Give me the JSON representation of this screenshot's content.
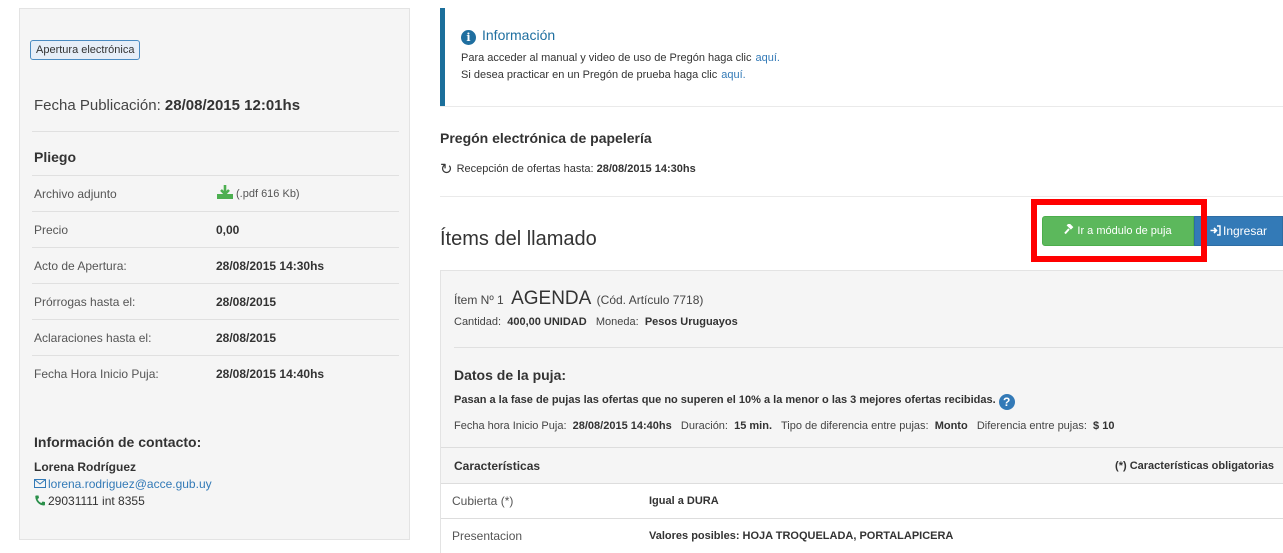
{
  "left": {
    "badge": "Apertura electrónica",
    "pub_label": "Fecha Publicación:",
    "pub_value": "28/08/2015 12:01hs",
    "pliego_title": "Pliego",
    "rows": [
      {
        "label": "Archivo adjunto",
        "value": "(.pdf 616 Kb)"
      },
      {
        "label": "Precio",
        "value": "0,00"
      },
      {
        "label": "Acto de Apertura:",
        "value": "28/08/2015 14:30hs"
      },
      {
        "label": "Prórrogas hasta el:",
        "value": "28/08/2015"
      },
      {
        "label": "Aclaraciones hasta el:",
        "value": "28/08/2015"
      },
      {
        "label": "Fecha Hora Inicio Puja:",
        "value": "28/08/2015 14:40hs"
      }
    ],
    "contact_title": "Información de contacto:",
    "contact_name": "Lorena Rodríguez",
    "contact_email": "lorena.rodriguez@acce.gub.uy",
    "contact_phone": "29031111 int 8355"
  },
  "info": {
    "title": "Información",
    "line1": "Para acceder al manual y video de uso de Pregón haga clic",
    "line2": "Si desea practicar en un Pregón de prueba haga clic",
    "link": "aquí."
  },
  "main": {
    "title": "Pregón electrónica de papelería",
    "reception_label": "Recepción de ofertas hasta:",
    "reception_value": "28/08/2015 14:30hs",
    "items_title": "Ítems del llamado",
    "btn_puja": "Ir a módulo de puja",
    "btn_ingresar": "Ingresar"
  },
  "item": {
    "num": "Ítem Nº 1",
    "name": "AGENDA",
    "code": "(Cód. Artículo 7718)",
    "qty_label": "Cantidad:",
    "qty_value": "400,00 UNIDAD",
    "currency_label": "Moneda:",
    "currency_value": "Pesos Uruguayos",
    "puja_title": "Datos de la puja:",
    "puja_desc": "Pasan a la fase de pujas las ofertas que no superen el 10% a la menor o las 3 mejores ofertas recibidas.",
    "start_label": "Fecha hora Inicio Puja:",
    "start_value": "28/08/2015 14:40hs",
    "dur_label": "Duración:",
    "dur_value": "15 min.",
    "type_label": "Tipo de diferencia entre pujas:",
    "type_value": "Monto",
    "diff_label": "Diferencia entre pujas:",
    "diff_value": "$ 10",
    "car_head": "Características",
    "car_req": "(*) Características obligatorias",
    "car_rows": [
      {
        "k": "Cubierta (*)",
        "v": "Igual a DURA"
      },
      {
        "k": "Presentacion",
        "v": "Valores posibles: HOJA TROQUELADA, PORTALAPICERA"
      }
    ]
  },
  "colors": {
    "green_button": "#5cb85c",
    "blue_button": "#337ab7",
    "highlight": "#ff0000",
    "info_accent": "#1b6f9b"
  }
}
